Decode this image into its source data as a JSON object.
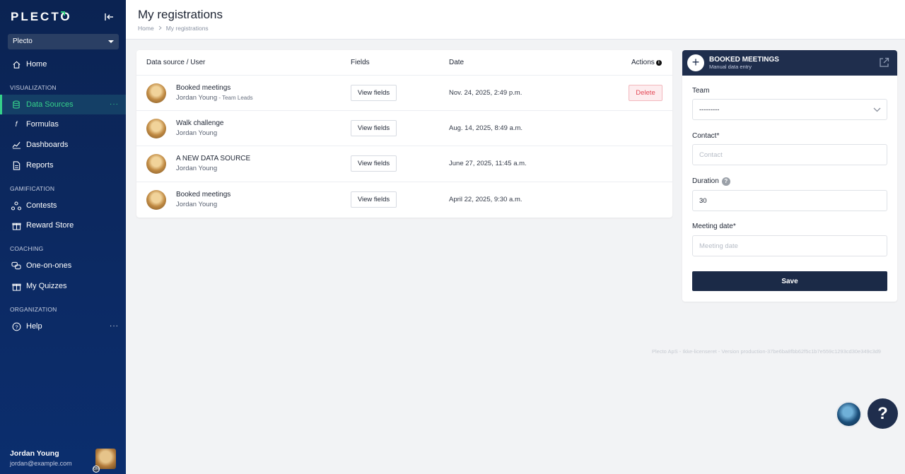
{
  "sidebar": {
    "logo": "PLECTO",
    "workspace": "Plecto",
    "items": {
      "home": "Home",
      "data_sources": "Data Sources",
      "formulas": "Formulas",
      "dashboards": "Dashboards",
      "reports": "Reports",
      "contests": "Contests",
      "reward_store": "Reward Store",
      "one_on_ones": "One-on-ones",
      "my_quizzes": "My Quizzes",
      "help": "Help"
    },
    "sections": {
      "visualization": "VISUALIZATION",
      "gamification": "GAMIFICATION",
      "coaching": "COACHING",
      "organization": "ORGANIZATION"
    },
    "more_dots": "···",
    "user": {
      "name": "Jordan Young",
      "email": "jordan@example.com",
      "badge": "ON"
    },
    "accent_color": "#35d18a"
  },
  "header": {
    "title": "My registrations",
    "breadcrumb": [
      "Home",
      "My registrations"
    ]
  },
  "table": {
    "columns": {
      "source": "Data source / User",
      "fields": "Fields",
      "date": "Date",
      "actions": "Actions"
    },
    "info_icon": "i",
    "view_fields_label": "View fields",
    "delete_label": "Delete",
    "rows": [
      {
        "source": "Booked meetings",
        "user": "Jordan Young",
        "team": " - Team Leads",
        "date": "Nov. 24, 2025, 2:49 p.m."
      },
      {
        "source": "Walk challenge",
        "user": "Jordan Young",
        "team": "",
        "date": "Aug. 14, 2025, 8:49 a.m."
      },
      {
        "source": "A NEW DATA SOURCE",
        "user": "Jordan Young",
        "team": "",
        "date": "June 27, 2025, 11:45 a.m."
      },
      {
        "source": "Booked meetings",
        "user": "Jordan Young",
        "team": "",
        "date": "April 22, 2025, 9:30 a.m."
      }
    ]
  },
  "panel": {
    "title": "BOOKED MEETINGS",
    "subtitle": "Manual data entry",
    "plus": "+",
    "team_label": "Team",
    "team_value": "---------",
    "contact_label": "Contact*",
    "contact_placeholder": "Contact",
    "duration_label": "Duration",
    "duration_help": "?",
    "duration_value": "30",
    "date_label": "Meeting date*",
    "date_placeholder": "Meeting date",
    "save_label": "Save"
  },
  "footer": {
    "version": "Plecto ApS - Ikke-licenseret - Version production-37be6ba8fbb62f5c1b7e559c1293cd30e349c3d9"
  },
  "help_fab": "?"
}
